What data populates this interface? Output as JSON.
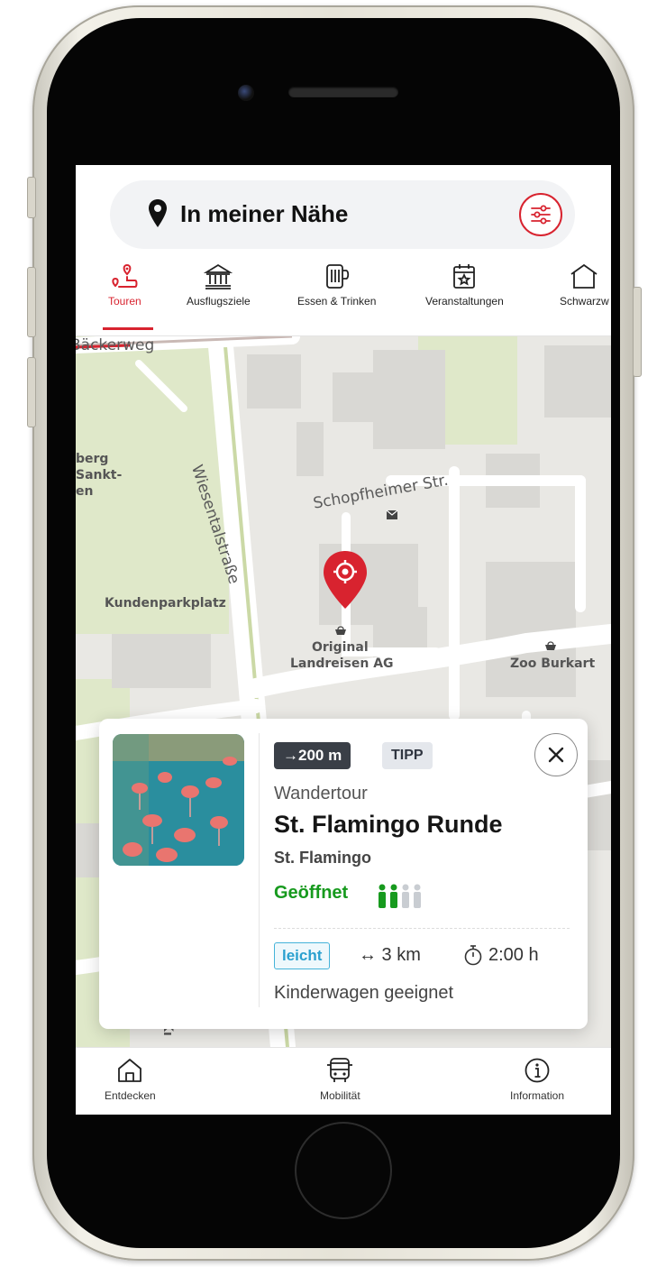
{
  "header": {
    "location_label": "In meiner Nähe",
    "pin_icon": "map-pin-icon",
    "filter_icon": "filter-sliders-icon"
  },
  "categories": [
    {
      "label": "Touren",
      "icon": "route-icon",
      "active": true
    },
    {
      "label": "Ausflugsziele",
      "icon": "museum-icon",
      "active": false
    },
    {
      "label": "Essen & Trinken",
      "icon": "mug-icon",
      "active": false
    },
    {
      "label": "Veranstaltungen",
      "icon": "calendar-star-icon",
      "active": false
    },
    {
      "label": "Schwarzw",
      "icon": "house-icon",
      "active": false
    }
  ],
  "map": {
    "labels": {
      "street1": "Bäckerweg",
      "street2": "Wiesentalstraße",
      "street3": "Schopfheimer Str.",
      "place1_line1": "berg",
      "place1_line2": "Sankt-",
      "place1_line3": "en",
      "parking": "Kundenparkplatz",
      "poi1_line1": "Original",
      "poi1_line2": "Landreisen AG",
      "poi2": "Zoo Burkart",
      "partial_ko": "Kı"
    },
    "marker_icon": "location-target-pin-icon",
    "accent_color": "#d8232f"
  },
  "card": {
    "distance": "→200 m",
    "tip_badge": "TIPP",
    "type": "Wandertour",
    "title": "St. Flamingo Runde",
    "subtitle": "St. Flamingo",
    "status": "Geöffnet",
    "status_color": "#179a1e",
    "occupancy_level": 2,
    "occupancy_max": 4,
    "difficulty": "leicht",
    "length": "↔ 3 km",
    "duration": "2:00 h",
    "note": "Kinderwagen geeignet",
    "close_icon": "close-icon",
    "image_icon": "flamingo-photo"
  },
  "bottom_nav": [
    {
      "label": "Entdecken",
      "icon": "home-icon"
    },
    {
      "label": "Mobilität",
      "icon": "bus-icon"
    },
    {
      "label": "Information",
      "icon": "info-icon"
    }
  ]
}
